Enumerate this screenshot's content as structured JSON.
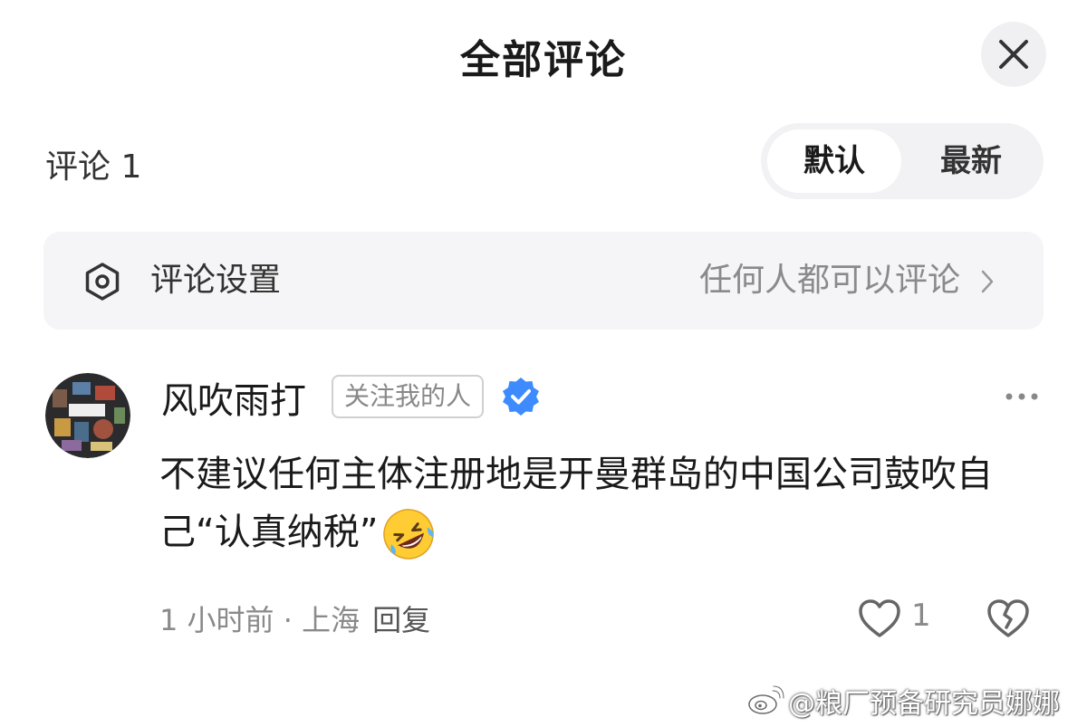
{
  "header": {
    "title": "全部评论",
    "close_icon": "close-icon"
  },
  "comments_bar": {
    "count_label": "评论 1",
    "sort_options": [
      "默认",
      "最新"
    ],
    "active_sort": "默认"
  },
  "settings": {
    "icon": "settings-icon",
    "label": "评论设置",
    "value": "任何人都可以评论",
    "chevron": "chevron-right-icon"
  },
  "comment": {
    "author": "风吹雨打",
    "badge": "关注我的人",
    "verified": true,
    "verified_icon": "verified-badge-icon",
    "text": "不建议任何主体注册地是开曼群岛的中国公司鼓吹自己“认真纳税”",
    "emoji": "rolling-on-floor-laughing-emoji",
    "time": "1 小时前",
    "location": "上海",
    "separator": " · ",
    "reply_label": "回复",
    "likes": "1",
    "more_icon": "more-icon"
  },
  "watermark": {
    "text": "@粮厂预备研究员娜娜",
    "icon": "weibo-logo-icon"
  },
  "colors": {
    "accent_verified": "#3d8bff",
    "text_primary": "#1a1a1a",
    "text_secondary": "#8a8a8a",
    "panel_bg": "#f5f5f7"
  }
}
